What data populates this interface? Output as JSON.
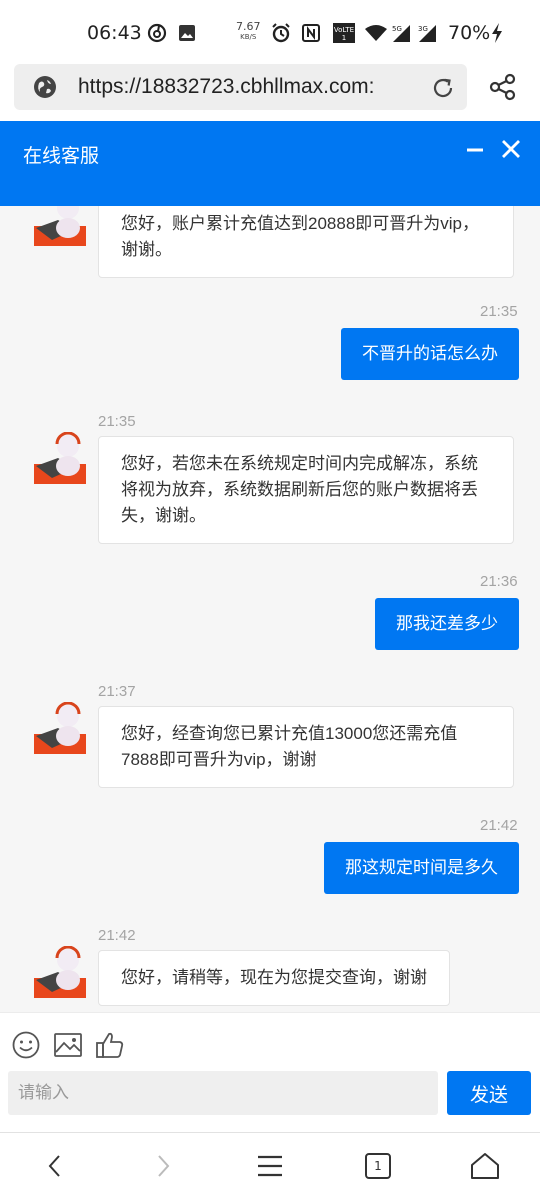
{
  "status_bar": {
    "time": "06:43",
    "net_speed": "7.67",
    "net_speed_unit": "KB/S",
    "battery": "70%",
    "icons": [
      "netease-music-icon",
      "image-icon",
      "alarm-icon",
      "nfc-icon",
      "volte-icon",
      "wifi-icon",
      "signal-5g-icon",
      "signal-3g-icon",
      "charging-icon"
    ]
  },
  "browser": {
    "url": "https://18832723.cbhllmax.com:"
  },
  "chat": {
    "title": "在线客服",
    "messages": [
      {
        "dir": "in",
        "text": "您好，账户累计充值达到20888即可晋升为vip，谢谢。"
      },
      {
        "dir": "out",
        "time": "21:35",
        "text": "不晋升的话怎么办"
      },
      {
        "dir": "in",
        "time": "21:35",
        "text": "您好，若您未在系统规定时间内完成解冻，系统将视为放弃，系统数据刷新后您的账户数据将丢失，谢谢。"
      },
      {
        "dir": "out",
        "time": "21:36",
        "text": "那我还差多少"
      },
      {
        "dir": "in",
        "time": "21:37",
        "text": "您好，经查询您已累计充值13000您还需充值7888即可晋升为vip，谢谢"
      },
      {
        "dir": "out",
        "time": "21:42",
        "text": "那这规定时间是多久"
      },
      {
        "dir": "in",
        "time": "21:42",
        "text": "您好，请稍等，现在为您提交查询，谢谢"
      }
    ]
  },
  "composer": {
    "placeholder": "请输入",
    "send_label": "发送"
  },
  "navbar": {
    "tab_count": "1"
  },
  "colors": {
    "accent": "#0077f2",
    "chat_bg": "#f6f6f6"
  }
}
